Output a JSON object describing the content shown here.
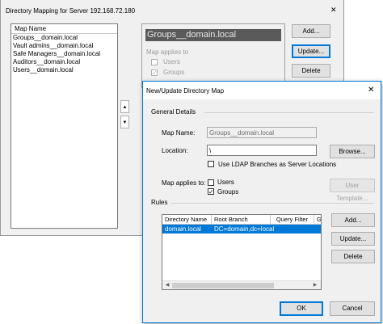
{
  "back_window": {
    "title": "Directory Mapping for Server 192.168.72.180",
    "list_header": "Map Name",
    "list_items": [
      "Groups__domain.local",
      "Vault admins__domain.local",
      "Safe Managers__domain.local",
      "Auditors__domain.local",
      "Users__domain.local"
    ],
    "selected_name": "Groups__domain.local",
    "map_applies_label": "Map applies to",
    "users_label": "Users",
    "groups_label": "Groups",
    "add_label": "Add...",
    "update_label": "Update...",
    "delete_label": "Delete",
    "close_glyph": "✕"
  },
  "dialog": {
    "title": "New/Update Directory Map",
    "close_glyph": "✕",
    "general_details": "General Details",
    "map_name_label": "Map Name:",
    "map_name_value": "Groups__domain.local",
    "location_label": "Location:",
    "location_value": "\\",
    "browse_label": "Browse...",
    "ldap_branches_label": "Use LDAP Branches as Server Locations",
    "map_applies_label": "Map applies to:",
    "users_label": "Users",
    "groups_label": "Groups",
    "groups_check": "✓",
    "user_template_label": "User Template...",
    "rules_label": "Rules",
    "table_headers": [
      "Directory Name",
      "Root Branch",
      "Query Filter",
      "Gr"
    ],
    "rows": [
      {
        "directory_name": "domain.local",
        "root_branch": "DC=domain,dc=local",
        "query_filter": "",
        "group": ""
      }
    ],
    "add_label": "Add...",
    "update_label": "Update...",
    "delete_label": "Delete",
    "ok_label": "OK",
    "cancel_label": "Cancel"
  },
  "colors": {
    "selection": "#0078d7",
    "window_bg": "#f0f0f0",
    "dark_field": "#5a5a5a"
  }
}
